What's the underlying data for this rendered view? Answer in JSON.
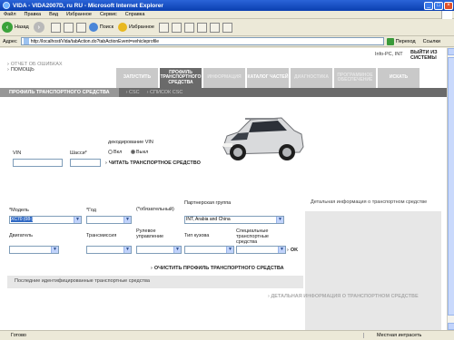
{
  "window": {
    "title": "VIDA - VIDA2007D, ru RU - Microsoft Internet Explorer"
  },
  "menu": [
    "Файл",
    "Правка",
    "Вид",
    "Избранное",
    "Сервис",
    "Справка"
  ],
  "toolbar": {
    "back": "Назад",
    "search": "Поиск",
    "favorites": "Избранное"
  },
  "address": {
    "label": "Адрес",
    "url": "http://localhost/Vida/tabAction.do?tabActionEvent=vehicleprofile",
    "go": "Переход",
    "links": "Ссылки"
  },
  "app": {
    "error_report": "ОТЧЕТ ОБ ОШИБКАХ",
    "help": "ПОМОЩЬ",
    "user_info": "Info-PC, INT",
    "exit": "ВЫЙТИ ИЗ СИСТЕМЫ",
    "tabs": [
      {
        "label": "ЗАПУСТИТЬ",
        "state": "off"
      },
      {
        "label": "ПРОФИЛЬ ТРАНСПОРТНОГО СРЕДСТВА",
        "state": "on"
      },
      {
        "label": "ИНФОРМАЦИЯ",
        "state": "dim"
      },
      {
        "label": "КАТАЛОГ ЧАСТЕЙ",
        "state": "off"
      },
      {
        "label": "ДИАГНОСТИКА",
        "state": "dim"
      },
      {
        "label": "ПРОГРАММНОЕ ОБЕСПЕЧЕНИЕ",
        "state": "dim"
      },
      {
        "label": "ИСКАТЬ",
        "state": "off"
      }
    ],
    "subnav": {
      "active": "ПРОФИЛЬ ТРАНСПОРТНОГО СРЕДСТВА",
      "items": [
        "CSC",
        "СПИСОК CSC"
      ]
    }
  },
  "form": {
    "vin_label": "VIN",
    "chassis_label": "Шасси*",
    "decode_label": "декодирование VIN",
    "decode_on": "Вкл",
    "decode_off": "Выкл",
    "read_vehicle": "ЧИТАТЬ ТРАНСПОРТНОЕ СРЕДСТВО",
    "model_label": "*Модель",
    "model_value": "XC70 (08-)",
    "year_label": "*Год",
    "mandatory_note": "(*обязательный)",
    "partner_label": "Партнерская группа",
    "partner_value": "INT, Arabia and China",
    "engine_label": "Двигатель",
    "transmission_label": "Трансмиссия",
    "steering_label": "Рулевое управление",
    "body_label": "Тип кузова",
    "special_label": "Специальные транспортные средства",
    "ok": "OK",
    "clear_profile": "ОЧИСТИТЬ ПРОФИЛЬ ТРАНСПОРТНОГО СРЕДСТВА"
  },
  "panels": {
    "detail_header": "Детальная информация о транспортном средстве",
    "recent_header": "Последние идентифицированные транспортные средства",
    "detail_link": "ДЕТАЛЬНАЯ ИНФОРМАЦИЯ О ТРАНСПОРТНОМ СРЕДСТВЕ"
  },
  "status": {
    "ready": "Готово",
    "zone": "Местная интрасеть"
  }
}
